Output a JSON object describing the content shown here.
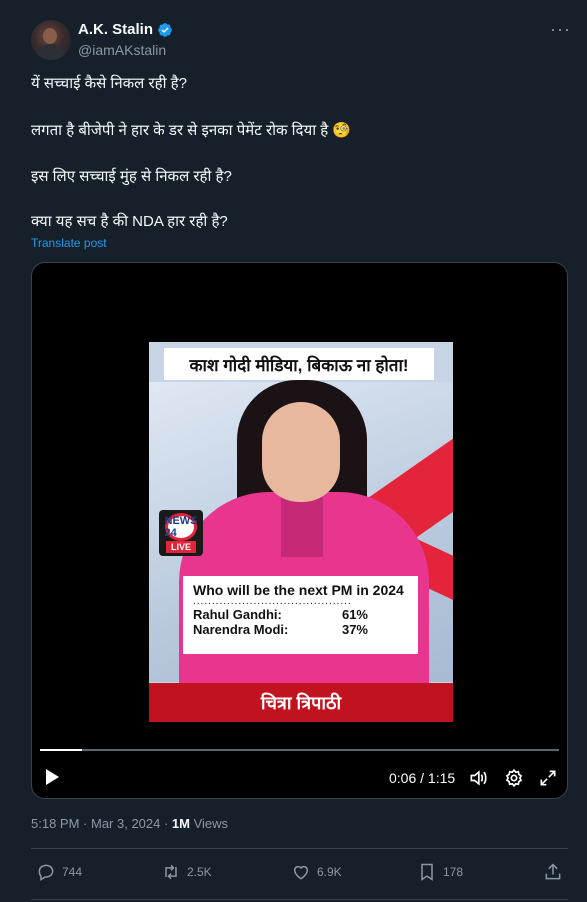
{
  "author": {
    "display_name": "A.K. Stalin",
    "handle": "@iamAKstalin",
    "verified": true
  },
  "tweet": {
    "lines": [
      "यें सच्चाई कैसे निकल रही है?",
      "लगता है बीजेपी ने हार के डर से इनका पेमेंट रोक दिया है 🧐",
      "इस लिए सच्चाई मुंह से निकल रही है?",
      "क्या यह सच है की NDA हार रही है?"
    ],
    "translate_label": "Translate post"
  },
  "video": {
    "headline": "काश गोदी मीडिया, बिकाऊ ना होता!",
    "logo_top": "NEWS 24",
    "logo_live": "LIVE",
    "poll_question": "Who will be the next PM in 2024",
    "poll_dots": "..........................................",
    "poll_rows": [
      {
        "name": "Rahul Gandhi:",
        "pct": "61%"
      },
      {
        "name": "Narendra Modi:",
        "pct": "37%"
      }
    ],
    "caption": "चित्रा त्रिपाठी",
    "time_display": "0:06 / 1:15",
    "progress_fraction": 0.08
  },
  "meta": {
    "time": "5:18 PM",
    "sep": " · ",
    "date": "Mar 3, 2024",
    "views_count": "1M",
    "views_label": "Views"
  },
  "actions": {
    "replies": "744",
    "reposts": "2.5K",
    "likes": "6.9K",
    "bookmarks": "178"
  },
  "colors": {
    "background": "#15202b",
    "accent": "#1d9bf0",
    "muted": "#8b98a5",
    "border": "#38444d"
  }
}
